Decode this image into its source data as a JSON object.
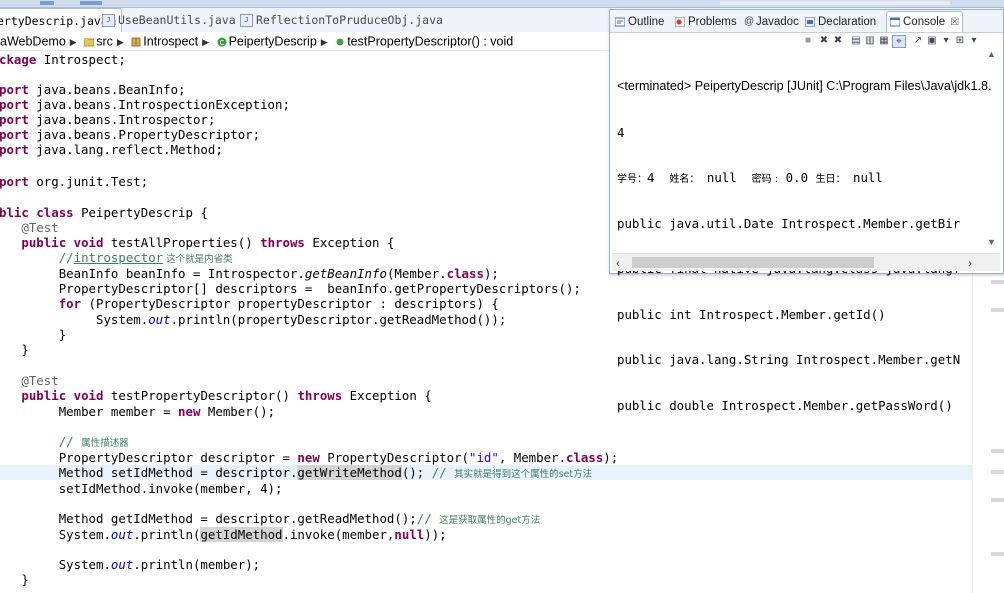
{
  "editor_tabs": [
    {
      "label": "ertyDescrip.java",
      "active": true
    },
    {
      "label": "UseBeanUtils.java",
      "active": false
    },
    {
      "label": "ReflectionToPruduceObj.java",
      "active": false
    }
  ],
  "breadcrumb": {
    "project": "aWebDemo",
    "folder": "src",
    "package": "Introspect",
    "class": "PeipertyDescrip",
    "method": "testPropertyDescriptor() : void"
  },
  "code": {
    "l1_kw": "ckage",
    "l1_rest": " Introspect;",
    "imp_kw": "port",
    "imp1": " java.beans.BeanInfo;",
    "imp2": " java.beans.IntrospectionException;",
    "imp3": " java.beans.Introspector;",
    "imp4": " java.beans.PropertyDescriptor;",
    "imp5": " java.lang.reflect.Method;",
    "imp6": " org.junit.Test;",
    "cls_kw1": "blic",
    "cls_kw2": "class",
    "cls_name": " PeipertyDescrip {",
    "ann": "@Test",
    "public": "public",
    "void": "void",
    "m1_name": " testAllProperties() ",
    "throws": "throws",
    "exc": " Exception {",
    "c1_a": "//",
    "c1_b": "introspector",
    "c1_c": " 这个就是内省类",
    "l_bi_a": "BeanInfo beanInfo = Introspector.",
    "l_bi_b": "getBeanInfo",
    "l_bi_c": "(Member.",
    "class_kw": "class",
    "l_bi_d": ");",
    "l_pd": "PropertyDescriptor[] descriptors =  beanInfo.getPropertyDescriptors();",
    "for_kw": "for",
    "l_for": " (PropertyDescriptor propertyDescriptor : descriptors) {",
    "l_sys_a": "System.",
    "out": "out",
    "l_sys_b": ".println(propertyDescriptor.getReadMethod());",
    "close": "}",
    "m2_name": " testPropertyDescriptor() ",
    "l_mem_a": "Member member = ",
    "new_kw": "new",
    "l_mem_b": " Member();",
    "c2_a": "// ",
    "c2_b": "属性描述器",
    "l_desc_a": "PropertyDescriptor descriptor = ",
    "l_desc_b": " PropertyDescriptor(",
    "str_id": "\"id\"",
    "l_desc_c": ", Member.",
    "l_desc_d": ");",
    "l_set_a": "Method setIdMethod = descriptor.",
    "l_set_b": "getWriteMethod",
    "l_set_c": "(); ",
    "c3_a": "// ",
    "c3_b": "其实就是得到这个属性的set方法",
    "l_inv": "setIdMethod.invoke(member, 4);",
    "l_get_a": "Method getIdMethod = descriptor.getReadMethod();",
    "c4_a": "// ",
    "c4_b": "这是获取属性的get方法",
    "l_p2_a": "System.",
    "l_p2_b": ".println(",
    "l_p2_c": "getIdMethod",
    "l_p2_d": ".invoke(member,",
    "null_kw": "null",
    "l_p2_e": "));",
    "l_p3_b": ".println(member);"
  },
  "console": {
    "tabs": [
      "Outline",
      "Problems",
      "Javadoc",
      "Declaration",
      "Console"
    ],
    "terminated": "<terminated> PeipertyDescrip [JUnit] C:\\Program Files\\Java\\jdk1.8.",
    "lines": [
      "4",
      "public java.util.Date Introspect.Member.getBir",
      "public final native java.lang.Class java.lang.",
      "public int Introspect.Member.getId()",
      "public java.lang.String Introspect.Member.getN",
      "public double Introspect.Member.getPassWord()"
    ],
    "member_line": {
      "k1": "学号：",
      "v1": "4",
      "k2": "姓名：",
      "v2": "null",
      "k3": "密码 :",
      "v3": "0.0",
      "k4": "生日：",
      "v4": "null"
    }
  }
}
